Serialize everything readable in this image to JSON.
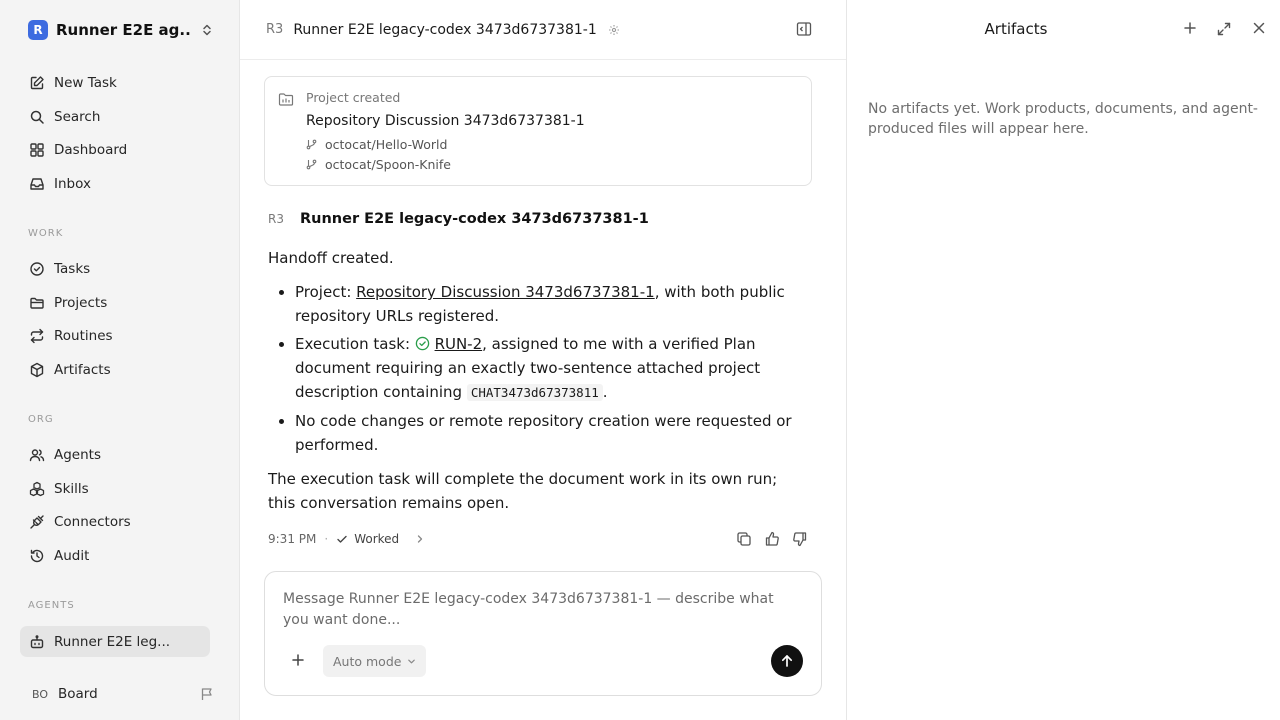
{
  "workspace": {
    "logo_letter": "R",
    "name": "Runner E2E ag..."
  },
  "nav": {
    "new_task": "New Task",
    "search": "Search",
    "dashboard": "Dashboard",
    "inbox": "Inbox"
  },
  "sections": {
    "work": "WORK",
    "org": "ORG",
    "agents": "AGENTS"
  },
  "work_items": {
    "tasks": "Tasks",
    "projects": "Projects",
    "routines": "Routines",
    "artifacts": "Artifacts"
  },
  "org_items": {
    "agents": "Agents",
    "skills": "Skills",
    "connectors": "Connectors",
    "audit": "Audit"
  },
  "agents_items": {
    "runner": "Runner E2E leg..."
  },
  "board": {
    "avatar": "BO",
    "label": "Board"
  },
  "header": {
    "badge": "R3",
    "title": "Runner E2E legacy-codex 3473d6737381-1"
  },
  "project_card": {
    "caption": "Project created",
    "name": "Repository Discussion 3473d6737381-1",
    "repos": [
      "octocat/Hello-World",
      "octocat/Spoon-Knife"
    ]
  },
  "message": {
    "badge": "R3",
    "author": "Runner E2E legacy-codex 3473d6737381-1",
    "intro": "Handoff created.",
    "b1_prefix": "Project: ",
    "b1_link": "Repository Discussion 3473d6737381-1",
    "b1_suffix": ", with both public repository URLs registered.",
    "b2_prefix": "Execution task: ",
    "b2_link": "RUN-2",
    "b2_mid": ", assigned to me with a verified Plan document requiring an exactly two-sentence attached project description containing ",
    "b2_code": "CHAT3473d67373811",
    "b2_end": ".",
    "b3": "No code changes or remote repository creation were requested or performed.",
    "outro": "The execution task will complete the document work in its own run; this conversation remains open.",
    "time": "9:31 PM",
    "sep": "·",
    "status": "Worked"
  },
  "composer": {
    "placeholder": "Message Runner E2E legacy-codex 3473d6737381-1 — describe what you want done...",
    "mode": "Auto mode"
  },
  "artifacts_panel": {
    "title": "Artifacts",
    "empty": "No artifacts yet. Work products, documents, and agent-produced files will appear here."
  },
  "colors": {
    "accent": "#3d6be0",
    "success": "#2a9d4a",
    "send": "#111111"
  }
}
